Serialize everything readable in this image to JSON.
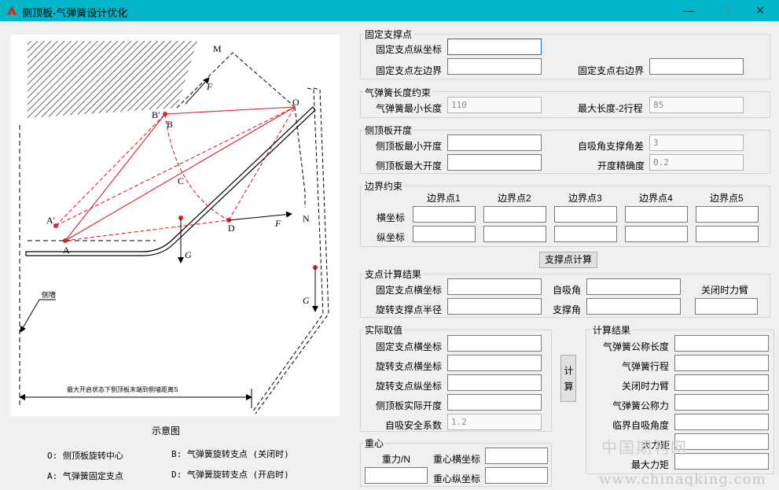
{
  "window": {
    "title": "侧顶板-气弹簧设计优化",
    "minimize_glyph": "—",
    "maximize_glyph": "☐",
    "close_glyph": "✕",
    "icon": "app-logo-icon"
  },
  "diagram": {
    "caption": "示意图",
    "labels": {
      "M": "M",
      "F_top": "F",
      "B_prime": "B′",
      "B": "B",
      "O": "O",
      "C": "C",
      "A_prime": "A′",
      "A": "A",
      "D": "D",
      "F_mid": "F",
      "N": "N",
      "G_mid": "G",
      "G_right": "G",
      "wall": "侧墙",
      "distance": "最大开启状态下侧顶板末端到侧墙距离S"
    },
    "legend": [
      "O: 侧顶板旋转中心",
      "B: 气弹簧旋转支点 (关闭时)",
      "A: 气弹簧固定支点",
      "D: 气弹簧旋转支点 (开启时)"
    ]
  },
  "fixed_support": {
    "title": "固定支撑点",
    "y_label": "固定支点纵坐标",
    "y_value": "",
    "left_label": "固定支点左边界",
    "left_value": "",
    "right_label": "固定支点右边界",
    "right_value": ""
  },
  "spring_length": {
    "title": "气弹簧长度约束",
    "min_label": "气弹簧最小长度",
    "min_value": "110",
    "max_label": "最大长度-2行程",
    "max_value": "85"
  },
  "panel_opening": {
    "title": "侧顶板开度",
    "min_label": "侧顶板最小开度",
    "min_value": "",
    "max_label": "侧顶板最大开度",
    "max_value": "",
    "self_lock_label": "自吸角支撑角差",
    "self_lock_value": "3",
    "precision_label": "开度精确度",
    "precision_value": "0.2"
  },
  "boundary": {
    "title": "边界约束",
    "columns": [
      "边界点1",
      "边界点2",
      "边界点3",
      "边界点4",
      "边界点5"
    ],
    "x_label": "横坐标",
    "y_label": "纵坐标"
  },
  "calc_support_button": "支撑点计算",
  "support_result": {
    "title": "支点计算结果",
    "fixed_x_label": "固定支点横坐标",
    "rot_radius_label": "旋转支撑点半径",
    "self_lock_angle_label": "自吸角",
    "support_angle_label": "支撑角",
    "closing_arm_label": "关闭时力臂"
  },
  "actual": {
    "title": "实际取值",
    "fixed_x_label": "固定支点横坐标",
    "rot_x_label": "旋转支点横坐标",
    "rot_y_label": "旋转支点纵坐标",
    "actual_open_label": "侧顶板实际开度",
    "safety_label": "自吸安全系数",
    "safety_value": "1.2"
  },
  "calc_button": "计算",
  "result": {
    "title": "计算结果",
    "nominal_length_label": "气弹簧公称长度",
    "stroke_label": "气弹簧行程",
    "closing_arm_label": "关闭时力臂",
    "nominal_force_label": "气弹簧公称力",
    "critical_angle_label": "临界自吸角度",
    "partial_label": "大力矩",
    "max_torque_label": "最大力矩"
  },
  "gravity": {
    "title": "重心",
    "weight_label": "重力/N",
    "cx_label": "重心横坐标",
    "cy_label": "重心纵坐标"
  },
  "watermark": {
    "cn": "中国期刊网",
    "url": "www.chinaqking.com"
  }
}
